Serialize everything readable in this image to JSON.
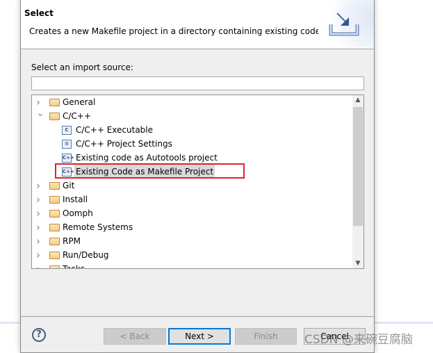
{
  "header": {
    "title": "Select",
    "description": "Creates a new Makefile project in a directory containing existing code",
    "banner_icon": "import-wizard-icon"
  },
  "source": {
    "label": "Select an import source:",
    "filter_value": "",
    "filter_placeholder": ""
  },
  "tree": {
    "items": [
      {
        "label": "General",
        "type": "folder",
        "expanded": false,
        "level": 0
      },
      {
        "label": "C/C++",
        "type": "folder",
        "expanded": true,
        "level": 0
      },
      {
        "label": "C/C++ Executable",
        "type": "c-file",
        "level": 1
      },
      {
        "label": "C/C++ Project Settings",
        "type": "settings",
        "level": 1
      },
      {
        "label": "Existing code as Autotools project",
        "type": "cpp-file",
        "level": 1
      },
      {
        "label": "Existing Code as Makefile Project",
        "type": "cpp-file",
        "level": 1,
        "selected": true,
        "highlighted": true
      },
      {
        "label": "Git",
        "type": "folder",
        "expanded": false,
        "level": 0
      },
      {
        "label": "Install",
        "type": "folder",
        "expanded": false,
        "level": 0
      },
      {
        "label": "Oomph",
        "type": "folder",
        "expanded": false,
        "level": 0
      },
      {
        "label": "Remote Systems",
        "type": "folder",
        "expanded": false,
        "level": 0
      },
      {
        "label": "RPM",
        "type": "folder",
        "expanded": false,
        "level": 0
      },
      {
        "label": "Run/Debug",
        "type": "folder",
        "expanded": false,
        "level": 0
      },
      {
        "label": "Tasks",
        "type": "folder",
        "expanded": false,
        "level": 0
      }
    ],
    "highlight_color": "#e0202a"
  },
  "buttons": {
    "back": "< Back",
    "next": "Next >",
    "finish": "Finish",
    "cancel": "Cancel"
  },
  "help_glyph": "?",
  "watermark": "CSDN @来碗豆腐脑"
}
